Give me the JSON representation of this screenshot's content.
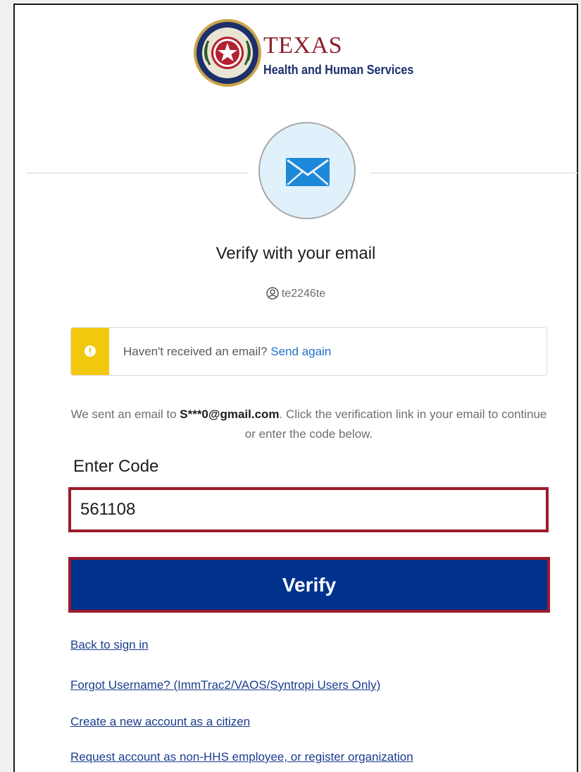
{
  "logo": {
    "title": "TEXAS",
    "subtitle": "Health and Human Services",
    "seal_icon": "texas-seal-icon"
  },
  "factor": {
    "icon": "envelope-icon",
    "heading": "Verify with your email",
    "username": "te2246te",
    "user_icon": "user-circle-icon"
  },
  "warning": {
    "icon": "warning-icon",
    "text": "Haven't received an email?",
    "link": "Send again",
    "color": "#f2c80f"
  },
  "message": {
    "prefix": "We sent an email to ",
    "email": "S***0@gmail.com",
    "suffix": ". Click the verification link in your email to continue or enter the code below."
  },
  "code": {
    "label": "Enter Code",
    "value": "561108"
  },
  "verify_button": {
    "label": "Verify",
    "color": "#00318c",
    "highlight_color": "#9b1b2b"
  },
  "links": [
    "Back to sign in",
    "Forgot Username? (ImmTrac2/VAOS/Syntropi Users Only)",
    "Create a new account as a citizen",
    "Request account as non-HHS employee, or register organization"
  ]
}
